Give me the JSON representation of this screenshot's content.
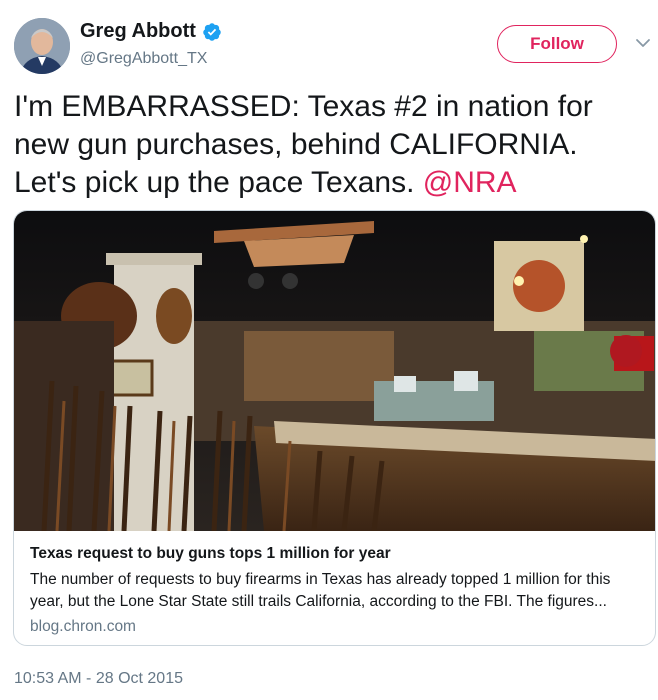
{
  "author": {
    "display_name": "Greg Abbott",
    "handle": "@GregAbbott_TX",
    "verified_icon": "verified-badge-icon"
  },
  "actions": {
    "follow_label": "Follow",
    "menu_icon": "chevron-down-icon"
  },
  "tweet": {
    "text": "I'm EMBARRASSED: Texas #2 in nation for new gun purchases, behind CALIFORNIA. Let's pick up the pace Texans. ",
    "mention": "@NRA"
  },
  "card": {
    "title": "Texas request to buy guns tops 1 million for year",
    "description": "The number of requests to buy firearms in Texas has already topped 1 million for this year, but the Lone Star State still trails California, according to the FBI. The figures...",
    "domain": "blog.chron.com"
  },
  "timestamp": "10:53 AM - 28 Oct 2015",
  "colors": {
    "accent": "#e0245e",
    "verified": "#1da1f2",
    "secondary_text": "#657786",
    "border": "#ccd6dd"
  }
}
